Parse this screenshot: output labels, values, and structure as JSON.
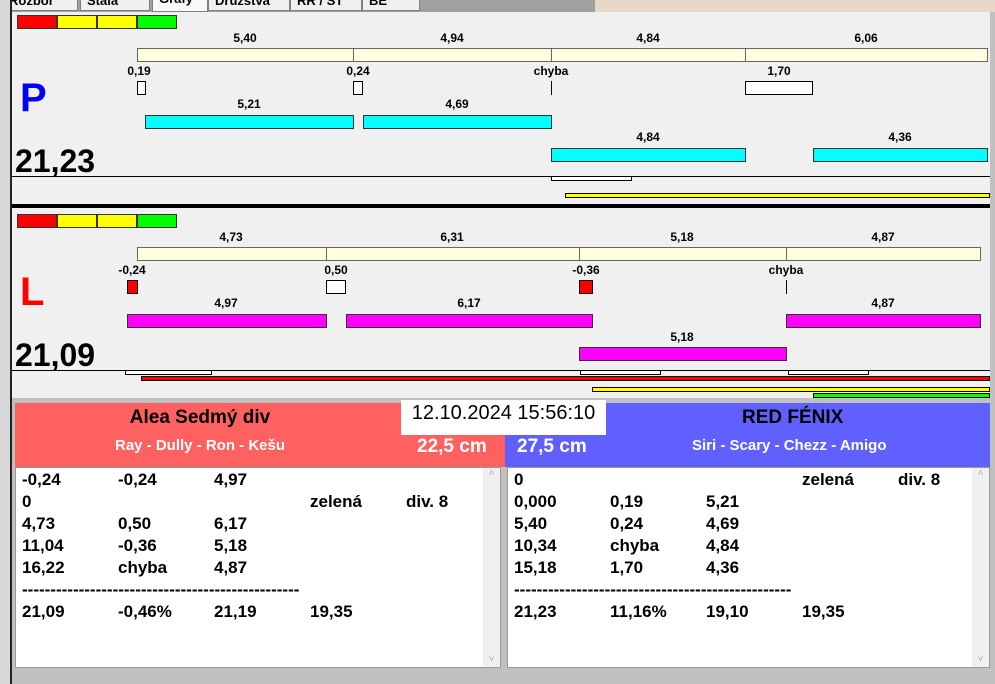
{
  "tabs": [
    "Rozbor",
    "Stála",
    "Grafy",
    "Družstva",
    "RR / ST",
    "BE"
  ],
  "colors": {
    "red": "#ff0000",
    "yellow": "#ffff00",
    "green": "#00ff00",
    "cyan": "#00ffff",
    "magenta": "#ff00ff",
    "team_left": "#ff6060",
    "team_right": "#6060ff"
  },
  "top": {
    "side": "P",
    "total": "21,23",
    "segments": [
      "5,40",
      "4,94",
      "4,84",
      "6,06"
    ],
    "deltas": [
      "0,19",
      "0,24",
      "chyba",
      "1,70"
    ],
    "row1": [
      "5,21",
      "4,69"
    ],
    "row2": [
      "4,84",
      "4,36"
    ]
  },
  "bottom": {
    "side": "L",
    "total": "21,09",
    "segments": [
      "4,73",
      "6,31",
      "5,18",
      "4,87"
    ],
    "deltas": [
      "-0,24",
      "0,50",
      "-0,36",
      "chyba"
    ],
    "row1": [
      "4,97",
      "6,17",
      "4,87"
    ],
    "row2": [
      "5,18"
    ]
  },
  "datetime": "12.10.2024 15:56:10",
  "left_team": {
    "name": "Alea Sedmý div",
    "players": "Ray - Dully - Ron - Kešu",
    "distance": "22,5 cm",
    "lines": [
      [
        "-0,24",
        "-0,24",
        "4,97",
        "",
        ""
      ],
      [
        "0",
        "",
        "",
        "zelená",
        "div. 8"
      ],
      [
        "4,73",
        "0,50",
        "6,17",
        "",
        ""
      ],
      [
        "11,04",
        "-0,36",
        "5,18",
        "",
        ""
      ],
      [
        "16,22",
        "chyba",
        "4,87",
        "",
        ""
      ],
      [
        "-------------------------------------------------",
        "",
        "",
        "",
        ""
      ],
      [
        "21,09",
        "-0,46%",
        "21,19",
        "19,35",
        ""
      ]
    ]
  },
  "right_team": {
    "name": "RED FÉNIX",
    "players": "Siri - Scary - Chezz - Amigo",
    "distance": "27,5 cm",
    "lines": [
      [
        "0",
        "",
        "",
        "zelená",
        "div. 8"
      ],
      [
        "0,000",
        "0,19",
        "5,21",
        "",
        ""
      ],
      [
        "5,40",
        "0,24",
        "4,69",
        "",
        ""
      ],
      [
        "10,34",
        "chyba",
        "4,84",
        "",
        ""
      ],
      [
        "15,18",
        "1,70",
        "4,36",
        "",
        ""
      ],
      [
        "-------------------------------------------------",
        "",
        "",
        "",
        ""
      ],
      [
        "21,23",
        "11,16%",
        "19,10",
        "19,35",
        ""
      ]
    ]
  }
}
